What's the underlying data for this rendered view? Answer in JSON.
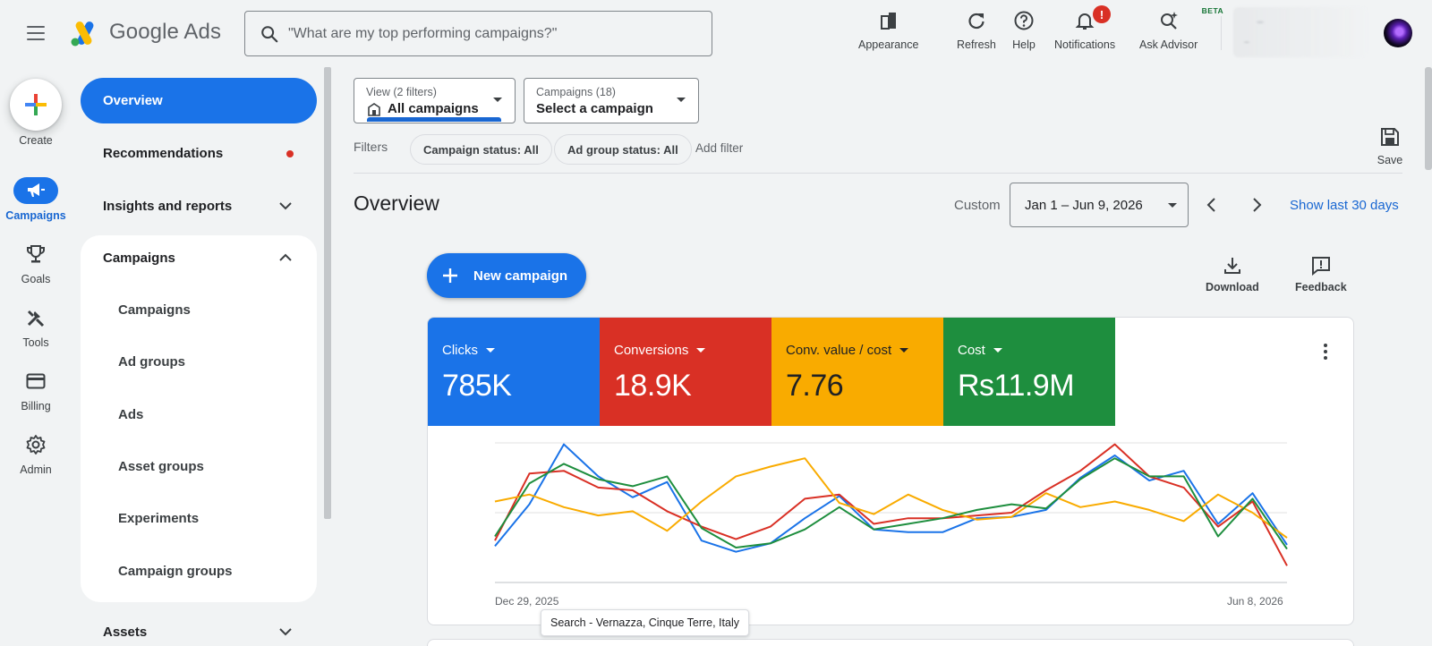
{
  "app": {
    "brand": "Google Ads",
    "search_placeholder": "\"What are my top performing campaigns?\"",
    "tools": [
      {
        "label": "Appearance",
        "icon": "appearance-icon"
      },
      {
        "label": "Refresh",
        "icon": "refresh-icon"
      },
      {
        "label": "Help",
        "icon": "help-icon"
      },
      {
        "label": "Notifications",
        "icon": "bell-icon",
        "badge": "!"
      },
      {
        "label": "Ask Advisor",
        "icon": "advisor-icon",
        "tag": "BETA"
      }
    ]
  },
  "rail": {
    "create_label": "Create",
    "items": [
      {
        "label": "Campaigns",
        "icon": "megaphone-icon",
        "active": true
      },
      {
        "label": "Goals",
        "icon": "trophy-icon"
      },
      {
        "label": "Tools",
        "icon": "tools-icon"
      },
      {
        "label": "Billing",
        "icon": "card-icon"
      },
      {
        "label": "Admin",
        "icon": "gear-icon"
      }
    ]
  },
  "nav": {
    "overview": "Overview",
    "recommendations": "Recommendations",
    "insights": "Insights and reports",
    "campaigns_group": "Campaigns",
    "sub_items": [
      "Campaigns",
      "Ad groups",
      "Ads",
      "Asset groups",
      "Experiments",
      "Campaign groups"
    ],
    "assets": "Assets"
  },
  "selectors": {
    "view_small": "View (2 filters)",
    "view_main": "All campaigns",
    "campaigns_small": "Campaigns (18)",
    "campaigns_main": "Select a campaign"
  },
  "filters": {
    "label": "Filters",
    "chips": [
      "Campaign status: All",
      "Ad group status: All"
    ],
    "add": "Add filter",
    "save": "Save"
  },
  "overview": {
    "title": "Overview",
    "custom": "Custom",
    "date_range": "Jan 1 – Jun 9, 2026",
    "show_last": "Show last 30 days",
    "new_campaign": "New campaign",
    "download": "Download",
    "feedback": "Feedback"
  },
  "metrics": [
    {
      "label": "Clicks",
      "value": "785K",
      "color": "#1a73e8"
    },
    {
      "label": "Conversions",
      "value": "18.9K",
      "color": "#d93025"
    },
    {
      "label": "Conv. value / cost",
      "value": "7.76",
      "color": "#f9ab00"
    },
    {
      "label": "Cost",
      "value": "Rs11.9M",
      "color": "#1e8e3e"
    }
  ],
  "chart_data": {
    "type": "line",
    "x_start_label": "Dec 29, 2025",
    "x_end_label": "Jun 8, 2026",
    "y_range": [
      0,
      100
    ],
    "grid": true,
    "series": [
      {
        "color": "#1a73e8",
        "values": [
          26,
          56,
          99,
          76,
          61,
          72,
          30,
          22,
          28,
          46,
          62,
          38,
          36,
          36,
          46,
          47,
          52,
          75,
          91,
          73,
          80,
          42,
          64,
          27
        ]
      },
      {
        "color": "#d93025",
        "values": [
          30,
          78,
          80,
          68,
          66,
          51,
          40,
          31,
          40,
          60,
          63,
          42,
          46,
          46,
          48,
          50,
          66,
          80,
          99,
          76,
          68,
          40,
          58,
          12
        ]
      },
      {
        "color": "#f9ab00",
        "values": [
          58,
          63,
          54,
          48,
          51,
          37,
          58,
          76,
          83,
          89,
          57,
          49,
          63,
          52,
          45,
          47,
          64,
          54,
          58,
          52,
          44,
          63,
          50,
          32
        ]
      },
      {
        "color": "#1e8e3e",
        "values": [
          33,
          71,
          85,
          74,
          69,
          76,
          39,
          25,
          28,
          38,
          54,
          38,
          42,
          46,
          52,
          56,
          53,
          74,
          89,
          76,
          76,
          33,
          60,
          24
        ]
      }
    ]
  },
  "tooltip": "Search - Vernazza, Cinque Terre, Italy"
}
